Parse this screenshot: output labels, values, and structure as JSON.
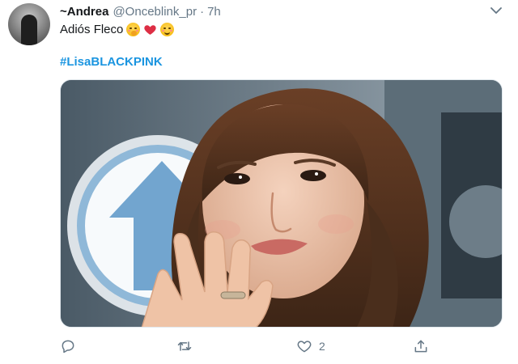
{
  "tweet": {
    "display_name": "~Andrea",
    "handle": "@Onceblink_pr",
    "separator": "·",
    "time": "7h",
    "text": "Adiós Fleco",
    "emoji": [
      "face-with-hand-over-mouth",
      "red-heart",
      "smiling-face"
    ],
    "hashtag": "#LisaBLACKPINK",
    "media_alt": "photo"
  },
  "actions": {
    "reply_count": "",
    "retweet_count": "",
    "like_count": "2",
    "share_count": ""
  },
  "colors": {
    "link": "#1b95e0",
    "secondary_text": "#657786",
    "heart": "#e0245e"
  }
}
